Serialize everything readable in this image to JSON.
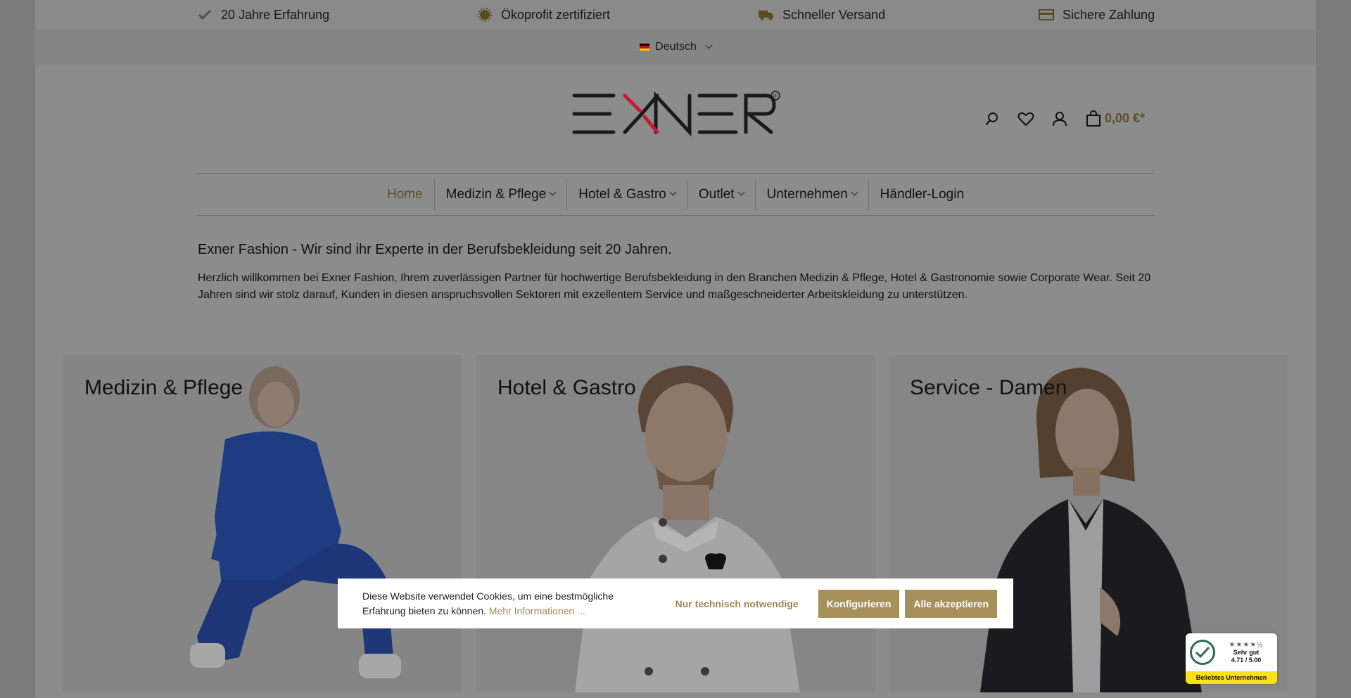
{
  "usp": [
    {
      "icon": "check-icon",
      "label": "20 Jahre Erfahrung"
    },
    {
      "icon": "seal-icon",
      "label": "Ökoprofit zertifiziert"
    },
    {
      "icon": "truck-icon",
      "label": "Schneller Versand"
    },
    {
      "icon": "credit-card-icon",
      "label": "Sichere Zahlung"
    }
  ],
  "language": {
    "label": "Deutsch",
    "flag": "germany-flag-icon"
  },
  "brand": {
    "name": "EXNER",
    "registered": "®",
    "accent": "#c51b2f"
  },
  "header": {
    "cart_total": "0,00 €*"
  },
  "nav": [
    {
      "label": "Home",
      "active": true
    },
    {
      "label": "Medizin & Pflege",
      "dropdown": true
    },
    {
      "label": "Hotel & Gastro",
      "dropdown": true
    },
    {
      "label": "Outlet",
      "dropdown": true
    },
    {
      "label": "Unternehmen",
      "dropdown": true
    },
    {
      "label": "Händler-Login"
    }
  ],
  "intro": {
    "title": "Exner Fashion - Wir sind ihr Experte in der Berufsbekleidung seit 20 Jahren.",
    "text": "Herzlich willkommen bei Exner Fashion, Ihrem zuverlässigen Partner für hochwertige Berufsbekleidung in den Branchen Medizin & Pflege, Hotel & Gastronomie sowie Corporate Wear.  Seit 20 Jahren sind wir stolz darauf, Kunden in diesen anspruchsvollen Sektoren mit exzellentem Service und maßgeschneiderter Arbeitskleidung zu unterstützen."
  },
  "categories": [
    {
      "title": "Medizin & Pflege"
    },
    {
      "title": "Hotel & Gastro"
    },
    {
      "title": "Service - Damen"
    }
  ],
  "cookie": {
    "text": "Diese Website verwendet Cookies, um eine bestmögliche Erfahrung bieten zu können.",
    "link": "Mehr Informationen ...",
    "btn_necessary": "Nur technisch notwendige",
    "btn_configure": "Konfigurieren",
    "btn_accept": "Alle akzeptieren"
  },
  "trust_badge": {
    "stars": "★★★★½",
    "rating_label": "Sehr gut",
    "score": "4.71 / 5.00",
    "footer": "Beliebtes Unternehmen"
  },
  "colors": {
    "accent_gold": "#a6905c",
    "overlay": "#808080"
  }
}
